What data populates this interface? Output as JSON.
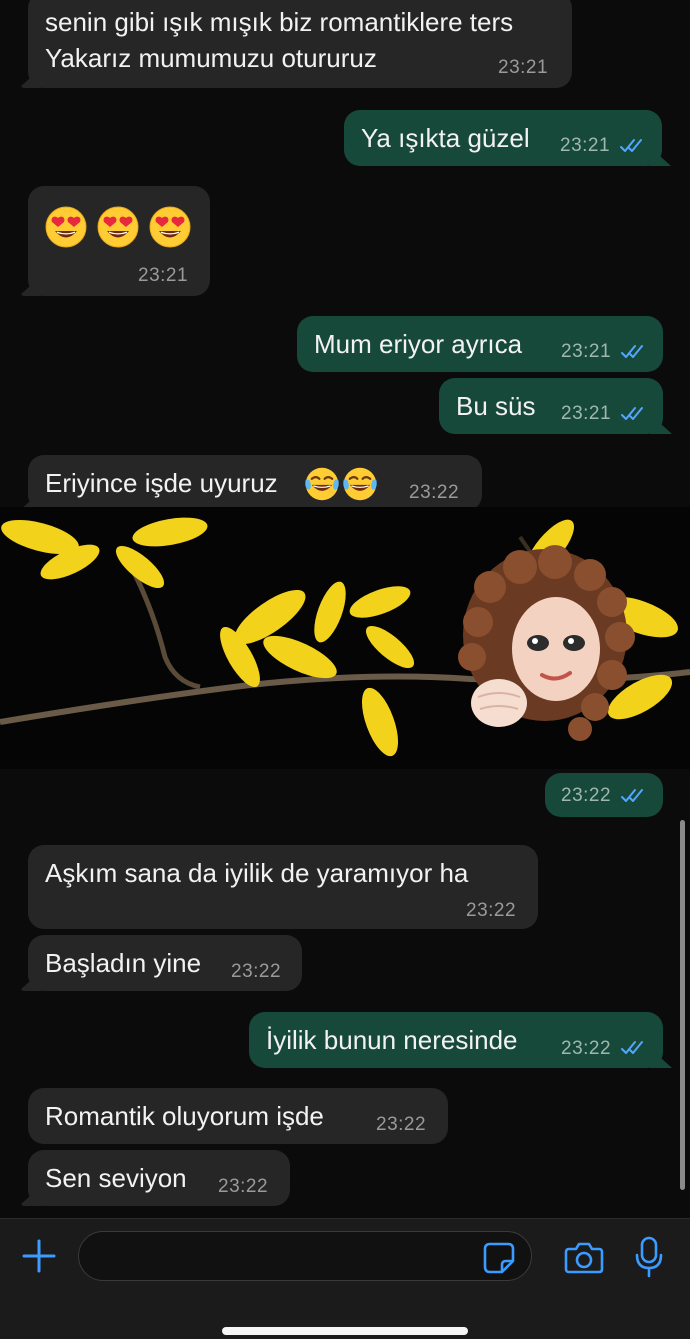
{
  "chat": {
    "messages": [
      {
        "dir": "in",
        "lines": [
          "senin gibi ışık mışık biz romantiklere ters",
          "Yakarız mumumuzu otururuz"
        ],
        "time": "23:21"
      },
      {
        "dir": "out",
        "text": "Ya ışıkta güzel",
        "time": "23:21",
        "status": "read"
      },
      {
        "dir": "in",
        "emojis": [
          "smiling-face-with-heart-eyes",
          "smiling-face-with-heart-eyes",
          "smiling-face-with-heart-eyes"
        ],
        "time": "23:21"
      },
      {
        "dir": "out",
        "text": "Mum eriyor ayrıca",
        "time": "23:21",
        "status": "read"
      },
      {
        "dir": "out",
        "text": "Bu süs",
        "time": "23:21",
        "status": "read"
      },
      {
        "dir": "in",
        "text": "Eriyince işde uyuruz",
        "emojis": [
          "face-with-tears-of-joy",
          "face-with-tears-of-joy"
        ],
        "time": "23:22"
      },
      {
        "dir": "out",
        "media": "photo-with-memoji-sticker",
        "time": "23:22",
        "status": "read"
      },
      {
        "dir": "in",
        "text": "Aşkım sana da iyilik de yaramıyor ha",
        "time": "23:22"
      },
      {
        "dir": "in",
        "text": "Başladın yine",
        "time": "23:22"
      },
      {
        "dir": "out",
        "text": "İyilik bunun neresinde",
        "time": "23:22",
        "status": "read"
      },
      {
        "dir": "in",
        "text": "Romantik oluyorum işde",
        "time": "23:22"
      },
      {
        "dir": "in",
        "text": "Sen seviyon",
        "time": "23:22"
      }
    ]
  },
  "composer": {
    "attach_icon": "plus-icon",
    "input_value": "",
    "sticker_icon": "sticker-icon",
    "camera_icon": "camera-icon",
    "mic_icon": "microphone-icon"
  },
  "colors": {
    "background": "#0b0b0b",
    "incoming_bubble": "#262626",
    "outgoing_bubble": "#17493a",
    "read_ticks": "#53a6ff",
    "accent": "#3b9bff"
  }
}
